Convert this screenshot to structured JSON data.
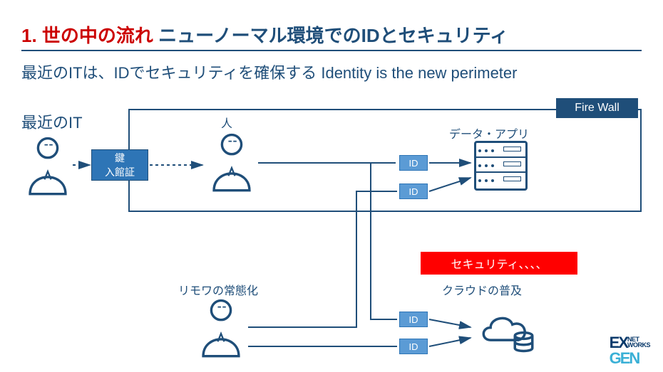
{
  "heading": {
    "number": "1.",
    "red_text": "世の中の流れ",
    "blue_text": "ニューノーマル環境でのIDとセキュリティ"
  },
  "subtitle": "最近のITは、IDでセキュリティを確保する Identity is the new perimeter",
  "recent_it_label": "最近のIT",
  "firewall_label": "Fire Wall",
  "labels": {
    "person": "人",
    "data_app": "データ・アプリ",
    "remote": "リモワの常態化",
    "cloud": "クラウドの普及"
  },
  "key_box": {
    "line1": "鍵",
    "line2": "入館証"
  },
  "id_label": "ID",
  "security_badge": "セキュリティ、、、、",
  "logo": {
    "ex": "EX",
    "gen": "GEN",
    "net": "NET",
    "works": "WORKS"
  },
  "colors": {
    "primary": "#1f4e79",
    "accent_red": "#ff0000",
    "id_fill": "#5b9bd5"
  }
}
